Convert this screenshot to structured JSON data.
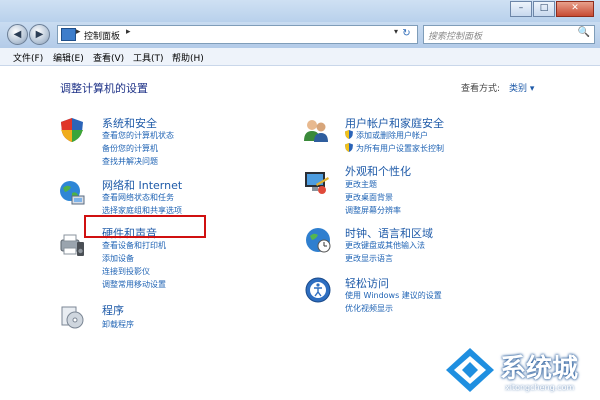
{
  "window": {
    "min": "–",
    "max": "□",
    "close": "✕"
  },
  "nav": {
    "back": "◀",
    "forward": "▶",
    "address_sep1": "▸",
    "address_text": "控制面板",
    "address_sep2": "▸",
    "address_dropdown": "▾",
    "refresh": "↻",
    "search_placeholder": "搜索控制面板",
    "search_icon": "search-icon"
  },
  "menu": [
    "文件(F)",
    "编辑(E)",
    "查看(V)",
    "工具(T)",
    "帮助(H)"
  ],
  "main": {
    "title": "调整计算机的设置",
    "view_by_label": "查看方式:",
    "view_by_value": "类别 ▾"
  },
  "categories": [
    {
      "icon": "security-shield-icon",
      "title": "系统和安全",
      "links": [
        "查看您的计算机状态",
        "备份您的计算机",
        "查找并解决问题"
      ]
    },
    {
      "icon": "network-globe-icon",
      "title": "网络和 Internet",
      "links": [
        "查看网络状态和任务",
        "选择家庭组和共享选项"
      ]
    },
    {
      "icon": "printer-speaker-icon",
      "title": "硬件和声音",
      "links": [
        "查看设备和打印机",
        "添加设备",
        "连接到投影仪",
        "调整常用移动设置"
      ]
    },
    {
      "icon": "programs-disk-icon",
      "title": "程序",
      "links": [
        "卸载程序"
      ]
    },
    {
      "icon": "users-icon",
      "title": "用户帐户和家庭安全",
      "links": [
        "添加或删除用户帐户",
        "为所有用户设置家长控制"
      ]
    },
    {
      "icon": "display-palette-icon",
      "title": "外观和个性化",
      "links": [
        "更改主题",
        "更改桌面背景",
        "调整屏幕分辨率"
      ]
    },
    {
      "icon": "clock-globe-icon",
      "title": "时钟、语言和区域",
      "links": [
        "更改键盘或其他输入法",
        "更改显示语言"
      ]
    },
    {
      "icon": "ease-of-access-icon",
      "title": "轻松访问",
      "links": [
        "使用 Windows 建议的设置",
        "优化视频显示"
      ]
    }
  ],
  "watermark": {
    "text": "系统城",
    "sub": "xitongcheng.com"
  },
  "colors": {
    "link": "#2265b5",
    "title": "#1e5aa8",
    "highlight": "#d01010"
  }
}
